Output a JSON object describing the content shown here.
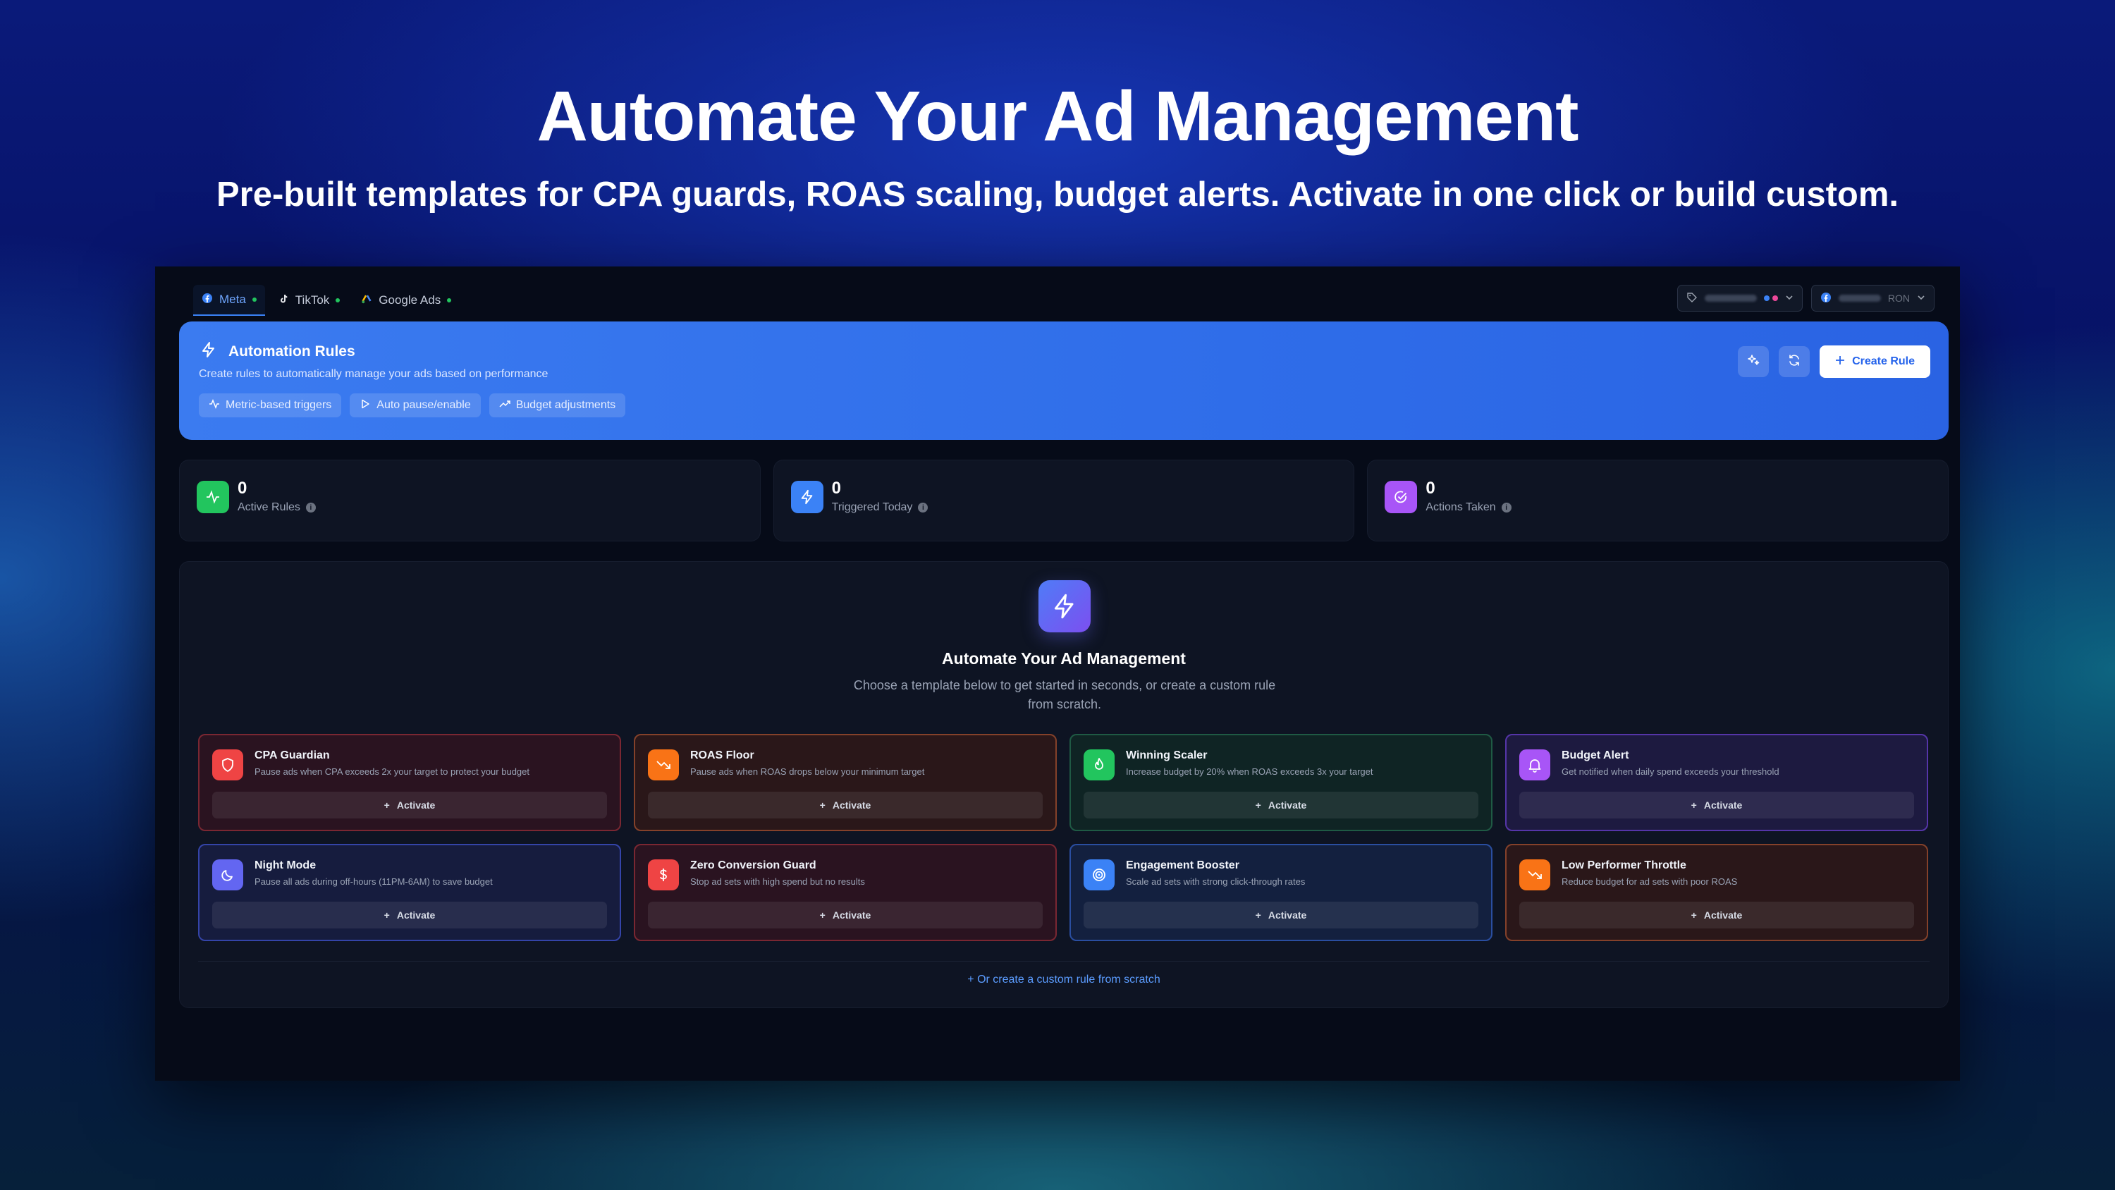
{
  "marketing": {
    "headline": "Automate Your Ad Management",
    "subline": "Pre-built templates for CPA guards, ROAS scaling, budget alerts. Activate in one click or build custom."
  },
  "platform_tabs": [
    {
      "label": "Meta",
      "icon": "meta-icon",
      "active": true
    },
    {
      "label": "TikTok",
      "icon": "tiktok-icon",
      "active": false
    },
    {
      "label": "Google Ads",
      "icon": "google-ads-icon",
      "active": false
    }
  ],
  "account_select": {
    "currency": "RON"
  },
  "hero": {
    "title": "Automation Rules",
    "description": "Create rules to automatically manage your ads based on performance",
    "features": [
      {
        "label": "Metric-based triggers",
        "icon": "activity-icon"
      },
      {
        "label": "Auto pause/enable",
        "icon": "play-icon"
      },
      {
        "label": "Budget adjustments",
        "icon": "trending-up-icon"
      }
    ],
    "create_button": "Create Rule"
  },
  "stats": [
    {
      "value": "0",
      "label": "Active Rules",
      "color": "#22c55e",
      "icon": "activity-icon"
    },
    {
      "value": "0",
      "label": "Triggered Today",
      "color": "#3b82f6",
      "icon": "bolt-icon"
    },
    {
      "value": "0",
      "label": "Actions Taken",
      "color": "#a855f7",
      "icon": "check-circle-icon"
    }
  ],
  "templates_panel": {
    "title": "Automate Your Ad Management",
    "description": "Choose a template below to get started in seconds, or create a custom rule from scratch.",
    "activate_label": "Activate",
    "templates": [
      {
        "title": "CPA Guardian",
        "description": "Pause ads when CPA exceeds 2x your target to protect your budget",
        "icon": "shield-icon",
        "color": "#ef4444"
      },
      {
        "title": "ROAS Floor",
        "description": "Pause ads when ROAS drops below your minimum target",
        "icon": "trending-down-icon",
        "color": "#f97316"
      },
      {
        "title": "Winning Scaler",
        "description": "Increase budget by 20% when ROAS exceeds 3x your target",
        "icon": "flame-icon",
        "color": "#22c55e"
      },
      {
        "title": "Budget Alert",
        "description": "Get notified when daily spend exceeds your threshold",
        "icon": "bell-icon",
        "color": "#a855f7"
      },
      {
        "title": "Night Mode",
        "description": "Pause all ads during off-hours (11PM-6AM) to save budget",
        "icon": "moon-icon",
        "color": "#6366f1"
      },
      {
        "title": "Zero Conversion Guard",
        "description": "Stop ad sets with high spend but no results",
        "icon": "dollar-icon",
        "color": "#ef4444"
      },
      {
        "title": "Engagement Booster",
        "description": "Scale ad sets with strong click-through rates",
        "icon": "target-icon",
        "color": "#3b82f6"
      },
      {
        "title": "Low Performer Throttle",
        "description": "Reduce budget for ad sets with poor ROAS",
        "icon": "trending-down-icon",
        "color": "#f97316"
      }
    ],
    "custom_link": "Or create a custom rule from scratch"
  }
}
